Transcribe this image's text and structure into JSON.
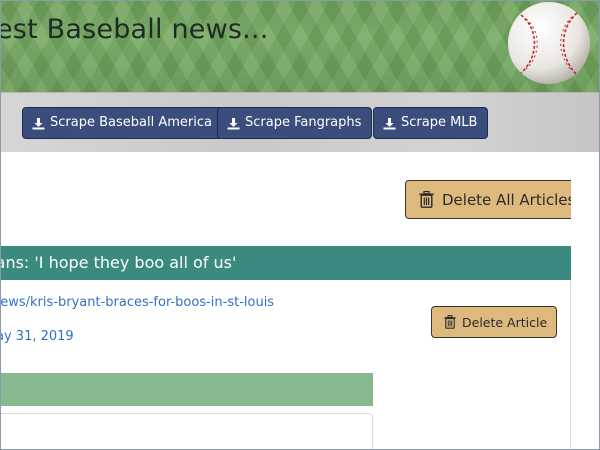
{
  "header": {
    "title": "est Baseball news...",
    "logo_icon": "baseball-icon"
  },
  "nav": {
    "buttons": [
      {
        "label": "Scrape Baseball America",
        "icon": "download-icon"
      },
      {
        "label": "Scrape Fangraphs",
        "icon": "download-icon"
      },
      {
        "label": "Scrape MLB",
        "icon": "download-icon"
      }
    ]
  },
  "main": {
    "delete_all_label": "Delete All Articles",
    "article": {
      "title": "fans: 'I hope they boo all of us'",
      "link": "news/kris-bryant-braces-for-boos-in-st-louis",
      "date": "ay 31, 2019",
      "delete_label": "Delete Article"
    }
  },
  "colors": {
    "nav_button": "#3b4d7c",
    "delete_button": "#deb97e",
    "card_header": "#3a8a7f",
    "sub_header": "#86b98f",
    "link": "#2f72c4"
  }
}
